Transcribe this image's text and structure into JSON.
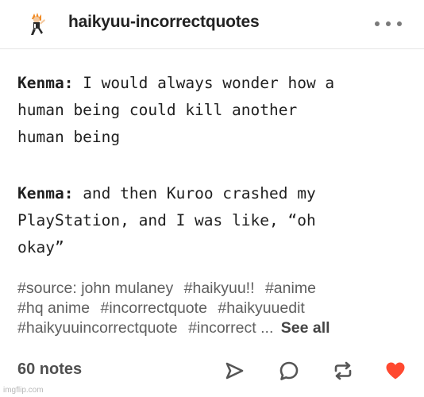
{
  "header": {
    "blog_name": "haikyuu-incorrectquotes",
    "avatar_icon": "blog-avatar-icon",
    "more_icon": "more-options-icon"
  },
  "quotes": [
    {
      "speaker": "Kenma:",
      "line_parts": [
        " I would always wonder how a",
        "human being could kill another",
        "human being"
      ]
    },
    {
      "speaker": "Kenma:",
      "line_parts": [
        " and then Kuroo crashed my",
        "PlayStation, and I was like, “oh",
        "okay”"
      ]
    }
  ],
  "tags": [
    "#source: john mulaney",
    "#haikyuu!!",
    "#anime",
    "#hq anime",
    "#incorrectquote",
    "#haikyuuedit",
    "#haikyuuincorrectquote",
    "#incorrect"
  ],
  "tags_ellipsis": "...",
  "see_all_label": "See all",
  "footer": {
    "notes": "60 notes",
    "icons": [
      "share-icon",
      "reply-icon",
      "reblog-icon",
      "like-heart-icon"
    ],
    "like_color": "#ff4930",
    "icon_color": "#555555"
  },
  "watermark": "imgflip.com"
}
